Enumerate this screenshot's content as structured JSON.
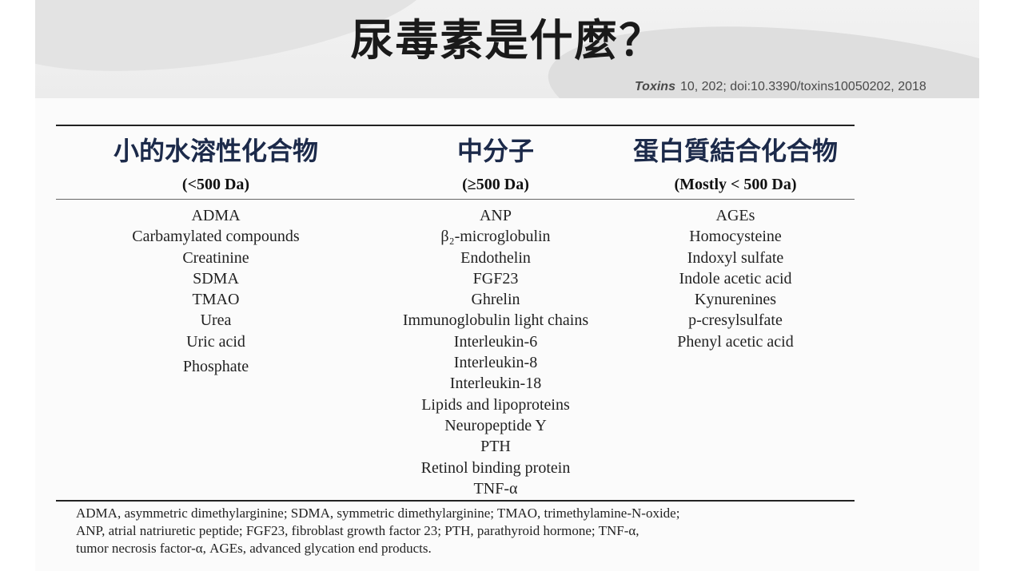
{
  "slide": {
    "title": "尿毒素是什麼？",
    "citation": {
      "journal": "Toxins",
      "rest": "10, 202; doi:10.3390/toxins10050202, 2018"
    }
  },
  "table": {
    "columns": [
      {
        "title": "小的水溶性化合物",
        "range": "(<500 Da)",
        "items": [
          "ADMA",
          "Carbamylated compounds",
          "Creatinine",
          "SDMA",
          "TMAO",
          "Urea",
          "Uric acid",
          "Phosphate"
        ]
      },
      {
        "title": "中分子",
        "range": "(≥500 Da)",
        "items": [
          "ANP",
          "β₂-microglobulin",
          "Endothelin",
          "FGF23",
          "Ghrelin",
          "Immunoglobulin light chains",
          "Interleukin-6",
          "Interleukin-8",
          "Interleukin-18",
          "Lipids and lipoproteins",
          "Neuropeptide Y",
          "PTH",
          "Retinol binding protein",
          "TNF-α"
        ]
      },
      {
        "title": "蛋白質結合化合物",
        "range": "(Mostly < 500 Da)",
        "items": [
          "AGEs",
          "Homocysteine",
          "Indoxyl sulfate",
          "Indole acetic acid",
          "Kynurenines",
          "p-cresylsulfate",
          "Phenyl acetic acid"
        ]
      }
    ]
  },
  "footnote": {
    "lines": [
      "ADMA, asymmetric dimethylarginine; SDMA, symmetric dimethylarginine; TMAO, trimethylamine-N-oxide;",
      "ANP, atrial natriuretic peptide; FGF23, fibroblast growth factor 23; PTH, parathyroid hormone; TNF-α,",
      "tumor necrosis factor-α, AGEs, advanced glycation end products."
    ]
  }
}
